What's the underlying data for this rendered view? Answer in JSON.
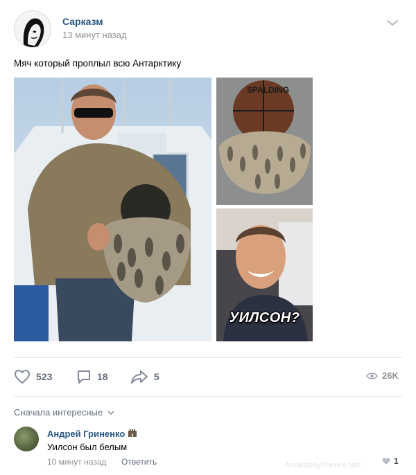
{
  "post": {
    "author": "Сарказм",
    "time": "13 минут назад",
    "text": "Мяч который проплыл всю Антарктику",
    "images": {
      "caption": "УИЛСОН?",
      "ball_brand": "SPALDING"
    }
  },
  "actions": {
    "likes": "523",
    "comments": "18",
    "shares": "5",
    "views": "26K"
  },
  "comments_sort": "Сначала интересные",
  "comment": {
    "author": "Андрей Гриненко",
    "text": "Уилсон был белым",
    "time": "10 минут назад",
    "reply_label": "Ответить",
    "likes": "1"
  },
  "watermark": "AnekdotByTheHot.Net",
  "icons": {
    "like": "heart-icon",
    "comment": "comment-icon",
    "share": "share-icon",
    "views": "eye-icon",
    "menu": "chevron-down-icon"
  },
  "colors": {
    "link": "#2a5885",
    "muted": "#939393",
    "action": "#626d7a"
  }
}
